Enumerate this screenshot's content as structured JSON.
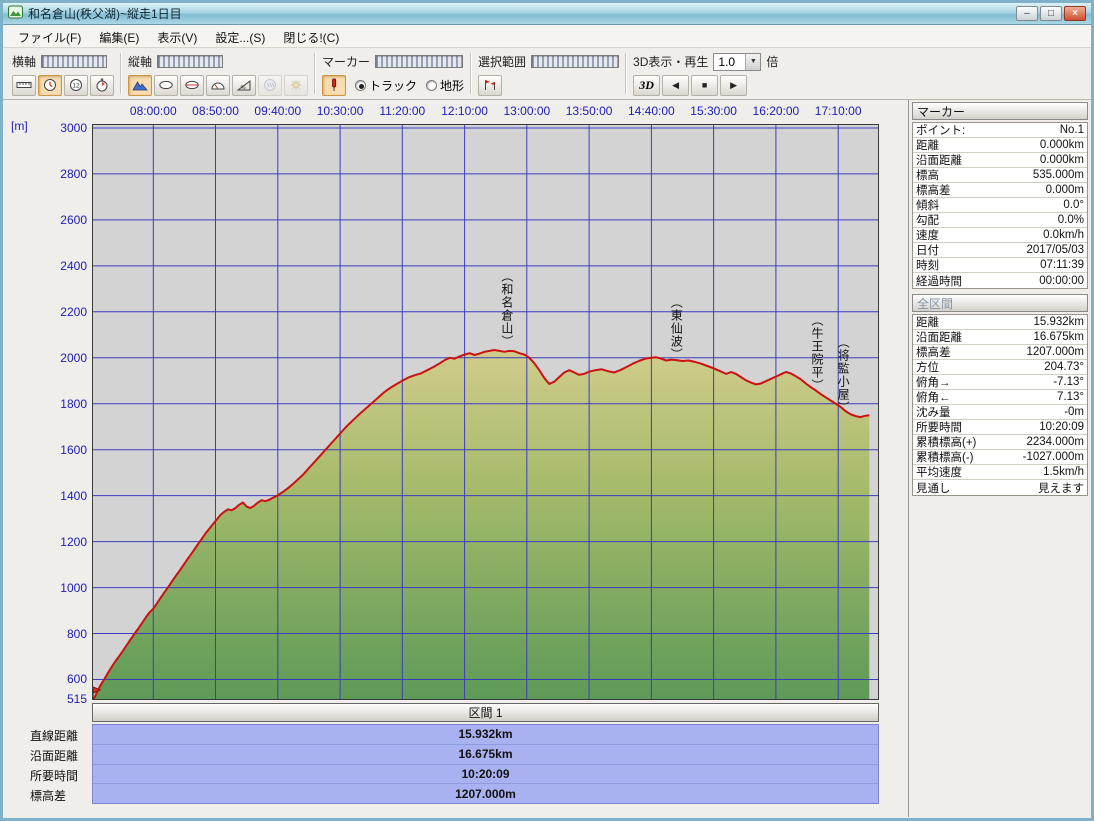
{
  "window": {
    "title": "和名倉山(秩父湖)~縦走1日目",
    "minimize_glyph": "–",
    "maximize_glyph": "□",
    "close_glyph": "×"
  },
  "menu": {
    "items": [
      "ファイル(F)",
      "編集(E)",
      "表示(V)",
      "設定...(S)",
      "閉じる!(C)"
    ]
  },
  "toolbar": {
    "h_axis_label": "横軸",
    "v_axis_label": "縦軸",
    "marker_label": "マーカー",
    "selection_label": "選択範囲",
    "view3d_label": "3D表示・再生",
    "speed_value": "1.0",
    "speed_unit": "倍",
    "btn_3d": "3D",
    "playback": [
      "◀",
      "■",
      "▶"
    ],
    "marker_radios": [
      {
        "label": "トラック",
        "selected": true
      },
      {
        "label": "地形",
        "selected": false
      }
    ],
    "haxis_icons": [
      {
        "name": "ruler-icon",
        "selected": false
      },
      {
        "name": "clock-icon",
        "selected": true
      },
      {
        "name": "clock-12-icon",
        "selected": false
      },
      {
        "name": "stopwatch-icon",
        "selected": false
      }
    ],
    "vaxis_icons": [
      {
        "name": "mountain-icon",
        "selected": true
      },
      {
        "name": "ellipse-icon",
        "selected": false
      },
      {
        "name": "terrain-profile-icon",
        "selected": false
      },
      {
        "name": "gauge-icon",
        "selected": false
      },
      {
        "name": "slope-icon",
        "selected": false
      },
      {
        "name": "rain-icon",
        "selected": false,
        "disabled": true
      },
      {
        "name": "sun-icon",
        "selected": false,
        "disabled": true
      }
    ]
  },
  "marker_panel": {
    "title": "マーカー",
    "rows": [
      {
        "label": "ポイント:",
        "value": "No.1"
      },
      {
        "label": "距離",
        "value": "0.000km"
      },
      {
        "label": "沿面距離",
        "value": "0.000km"
      },
      {
        "label": "標高",
        "value": "535.000m"
      },
      {
        "label": "標高差",
        "value": "0.000m"
      },
      {
        "label": "傾斜",
        "value": "0.0°"
      },
      {
        "label": "勾配",
        "value": "0.0%"
      },
      {
        "label": "速度",
        "value": "0.0km/h"
      },
      {
        "label": "日付",
        "value": "2017/05/03"
      },
      {
        "label": "時刻",
        "value": "07:11:39"
      },
      {
        "label": "経過時間",
        "value": "00:00:00"
      }
    ],
    "section2_title": "全区間",
    "rows2": [
      {
        "label": "距離",
        "value": "15.932km"
      },
      {
        "label": "沿面距離",
        "value": "16.675km"
      },
      {
        "label": "標高差",
        "value": "1207.000m"
      },
      {
        "label": "方位",
        "value": "204.73°"
      },
      {
        "label": "俯角→",
        "value": "-7.13°"
      },
      {
        "label": "俯角←",
        "value": "7.13°"
      },
      {
        "label": "沈み量",
        "value": "-0m"
      },
      {
        "label": "所要時間",
        "value": "10:20:09"
      },
      {
        "label": "累積標高(+)",
        "value": "2234.000m"
      },
      {
        "label": "累積標高(-)",
        "value": "-1027.000m"
      },
      {
        "label": "平均速度",
        "value": "1.5km/h"
      },
      {
        "label": "見通し",
        "value": "見えます"
      }
    ]
  },
  "bottom": {
    "section_title": "区間 1",
    "rows": [
      {
        "label": "直線距離",
        "value": "15.932km"
      },
      {
        "label": "沿面距離",
        "value": "16.675km"
      },
      {
        "label": "所要時間",
        "value": "10:20:09"
      },
      {
        "label": "標高差",
        "value": "1207.000m"
      }
    ]
  },
  "chart_data": {
    "type": "area",
    "title": "elevation-profile",
    "y_unit": "[m]",
    "x_min": 431.6,
    "x_max": 1062,
    "ylim": [
      515,
      3013
    ],
    "x_tick_labels": [
      "08:00:00",
      "08:50:00",
      "09:40:00",
      "10:30:00",
      "11:20:00",
      "12:10:00",
      "13:00:00",
      "13:50:00",
      "14:40:00",
      "15:30:00",
      "16:20:00",
      "17:10:00"
    ],
    "y_tick_labels": [
      3000,
      2800,
      2600,
      2400,
      2200,
      2000,
      1800,
      1600,
      1400,
      1200,
      1000,
      800,
      600,
      515
    ],
    "y_gridlines": [
      600,
      800,
      1000,
      1200,
      1400,
      1600,
      1800,
      2000,
      2200,
      2400,
      2600,
      2800,
      3000
    ],
    "grid": true,
    "plot_bg": "#d3d3d3",
    "grid_color": "#3c3cc0",
    "line_color": "#cc1111",
    "label_color": "#1c1cb8",
    "fill_stops": [
      "#5e9a58",
      "#a4ba6a",
      "#d9d092"
    ],
    "annotations": [
      {
        "label": "（和名倉山）",
        "t": 764,
        "top": 2380
      },
      {
        "label": "（東仙波）",
        "t": 900,
        "top": 2270
      },
      {
        "label": "（牛王院平）",
        "t": 1013,
        "top": 2190
      },
      {
        "label": "（将監小屋）",
        "t": 1034,
        "top": 2095
      }
    ],
    "profile": [
      [
        431.7,
        515
      ],
      [
        433,
        522
      ],
      [
        435,
        548
      ],
      [
        438,
        578
      ],
      [
        441,
        604
      ],
      [
        444,
        632
      ],
      [
        447,
        658
      ],
      [
        450,
        682
      ],
      [
        453,
        704
      ],
      [
        456,
        728
      ],
      [
        459,
        752
      ],
      [
        462,
        776
      ],
      [
        465,
        800
      ],
      [
        468,
        822
      ],
      [
        471,
        846
      ],
      [
        474,
        870
      ],
      [
        477,
        892
      ],
      [
        480,
        908
      ],
      [
        483,
        932
      ],
      [
        486,
        956
      ],
      [
        489,
        980
      ],
      [
        492,
        1002
      ],
      [
        495,
        1026
      ],
      [
        498,
        1050
      ],
      [
        501,
        1072
      ],
      [
        504,
        1096
      ],
      [
        507,
        1120
      ],
      [
        510,
        1142
      ],
      [
        513,
        1166
      ],
      [
        516,
        1190
      ],
      [
        519,
        1212
      ],
      [
        522,
        1236
      ],
      [
        525,
        1256
      ],
      [
        528,
        1276
      ],
      [
        531,
        1296
      ],
      [
        534,
        1316
      ],
      [
        537,
        1330
      ],
      [
        540,
        1340
      ],
      [
        543,
        1336
      ],
      [
        546,
        1346
      ],
      [
        549,
        1360
      ],
      [
        552,
        1370
      ],
      [
        555,
        1352
      ],
      [
        558,
        1346
      ],
      [
        561,
        1356
      ],
      [
        564,
        1370
      ],
      [
        567,
        1380
      ],
      [
        570,
        1376
      ],
      [
        573,
        1382
      ],
      [
        576,
        1390
      ],
      [
        580,
        1402
      ],
      [
        584,
        1416
      ],
      [
        588,
        1432
      ],
      [
        592,
        1450
      ],
      [
        596,
        1470
      ],
      [
        600,
        1490
      ],
      [
        605,
        1520
      ],
      [
        610,
        1550
      ],
      [
        615,
        1580
      ],
      [
        620,
        1610
      ],
      [
        625,
        1640
      ],
      [
        630,
        1670
      ],
      [
        635,
        1700
      ],
      [
        640,
        1726
      ],
      [
        645,
        1752
      ],
      [
        650,
        1776
      ],
      [
        655,
        1800
      ],
      [
        660,
        1824
      ],
      [
        665,
        1848
      ],
      [
        670,
        1868
      ],
      [
        675,
        1884
      ],
      [
        680,
        1900
      ],
      [
        685,
        1914
      ],
      [
        690,
        1924
      ],
      [
        695,
        1932
      ],
      [
        700,
        1946
      ],
      [
        705,
        1960
      ],
      [
        710,
        1976
      ],
      [
        714,
        1990
      ],
      [
        718,
        2000
      ],
      [
        722,
        1996
      ],
      [
        726,
        2006
      ],
      [
        730,
        2014
      ],
      [
        734,
        2020
      ],
      [
        738,
        2012
      ],
      [
        742,
        2018
      ],
      [
        746,
        2026
      ],
      [
        750,
        2030
      ],
      [
        754,
        2034
      ],
      [
        758,
        2030
      ],
      [
        762,
        2026
      ],
      [
        766,
        2030
      ],
      [
        770,
        2028
      ],
      [
        774,
        2020
      ],
      [
        778,
        2014
      ],
      [
        782,
        2000
      ],
      [
        786,
        1976
      ],
      [
        790,
        1946
      ],
      [
        794,
        1912
      ],
      [
        798,
        1886
      ],
      [
        802,
        1896
      ],
      [
        806,
        1916
      ],
      [
        810,
        1936
      ],
      [
        814,
        1946
      ],
      [
        818,
        1936
      ],
      [
        822,
        1926
      ],
      [
        826,
        1930
      ],
      [
        830,
        1940
      ],
      [
        835,
        1946
      ],
      [
        840,
        1950
      ],
      [
        845,
        1942
      ],
      [
        850,
        1936
      ],
      [
        855,
        1946
      ],
      [
        860,
        1960
      ],
      [
        865,
        1974
      ],
      [
        870,
        1986
      ],
      [
        875,
        1996
      ],
      [
        880,
        2000
      ],
      [
        884,
        2002
      ],
      [
        888,
        1996
      ],
      [
        892,
        1988
      ],
      [
        896,
        1992
      ],
      [
        900,
        1990
      ],
      [
        905,
        1986
      ],
      [
        910,
        1988
      ],
      [
        915,
        1982
      ],
      [
        920,
        1974
      ],
      [
        925,
        1964
      ],
      [
        930,
        1954
      ],
      [
        935,
        1942
      ],
      [
        940,
        1930
      ],
      [
        944,
        1938
      ],
      [
        948,
        1930
      ],
      [
        952,
        1916
      ],
      [
        956,
        1902
      ],
      [
        960,
        1892
      ],
      [
        964,
        1884
      ],
      [
        968,
        1888
      ],
      [
        972,
        1898
      ],
      [
        976,
        1908
      ],
      [
        980,
        1918
      ],
      [
        984,
        1928
      ],
      [
        988,
        1938
      ],
      [
        992,
        1932
      ],
      [
        996,
        1920
      ],
      [
        1000,
        1906
      ],
      [
        1004,
        1888
      ],
      [
        1008,
        1872
      ],
      [
        1012,
        1858
      ],
      [
        1016,
        1842
      ],
      [
        1020,
        1828
      ],
      [
        1024,
        1814
      ],
      [
        1028,
        1800
      ],
      [
        1032,
        1786
      ],
      [
        1036,
        1768
      ],
      [
        1040,
        1754
      ],
      [
        1044,
        1746
      ],
      [
        1048,
        1742
      ],
      [
        1052,
        1748
      ],
      [
        1055,
        1750
      ]
    ]
  }
}
